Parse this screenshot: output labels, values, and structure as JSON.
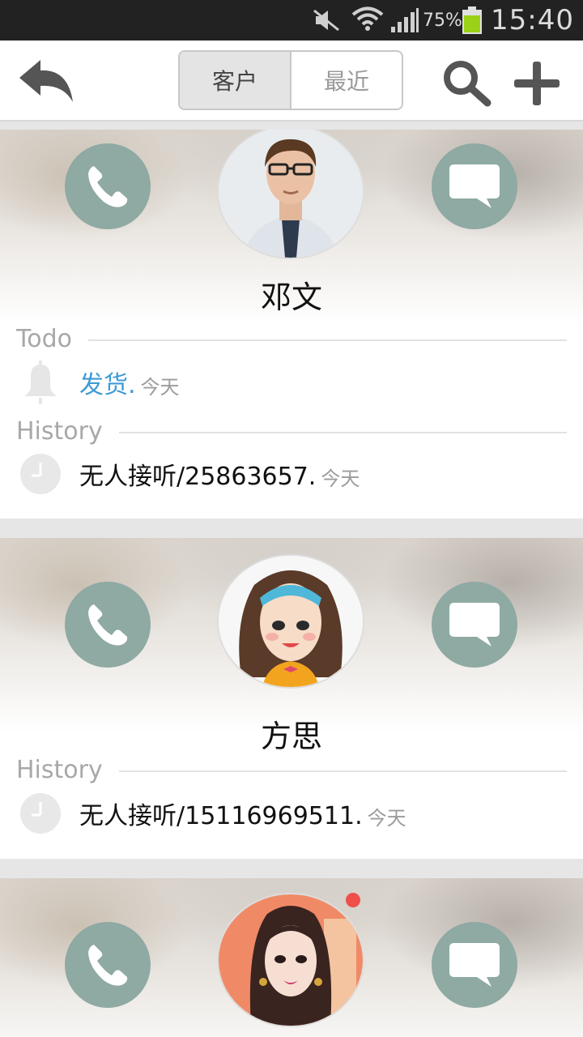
{
  "status_bar": {
    "battery_percent": "75%",
    "time": "15:40",
    "icons": [
      "mute-icon",
      "wifi-icon",
      "signal-icon",
      "battery-icon"
    ],
    "battery_color": "#9bd117"
  },
  "toolbar": {
    "tabs": [
      {
        "label": "客户",
        "active": true
      },
      {
        "label": "最近",
        "active": false
      }
    ],
    "icons": [
      "back-icon",
      "search-icon",
      "plus-icon"
    ]
  },
  "colors": {
    "action_circle": "#8fa9a3",
    "link": "#3e9bd6",
    "unread_dot": "#f0504a"
  },
  "contacts": [
    {
      "name": "邓文",
      "avatar": "man-with-glasses-avatar",
      "todo_title": "Todo",
      "todo": {
        "text": "发货.",
        "time": "今天"
      },
      "history_title": "History",
      "history": {
        "text": "无人接听/25863657.",
        "time": "今天"
      }
    },
    {
      "name": "方思",
      "avatar": "cartoon-girl-headband-avatar",
      "history_title": "History",
      "history": {
        "text": "无人接听/15116969511.",
        "time": "今天"
      }
    },
    {
      "name": "",
      "avatar": "cartoon-woman-avatar",
      "unread": true
    }
  ]
}
